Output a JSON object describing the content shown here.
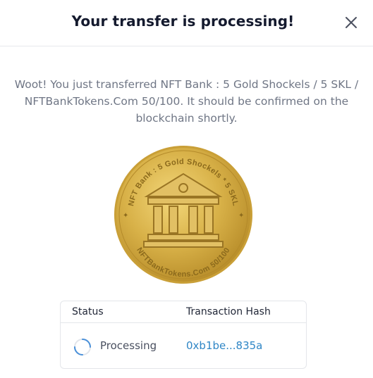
{
  "dialog": {
    "title": "Your transfer is processing!",
    "close_icon": "close-icon",
    "message": "Woot! You just transferred NFT Bank : 5 Gold Shockels / 5 SKL / NFTBankTokens.Com 50/100. It should be confirmed on the blockchain shortly."
  },
  "coin": {
    "top_text": "NFT Bank : 5 Gold Shockels * 5 SKL",
    "bottom_text": "NFTBankTokens.Com 50/100",
    "icon": "bank-building-icon",
    "gold_color": "#d8b148"
  },
  "table": {
    "headers": {
      "status": "Status",
      "hash": "Transaction Hash"
    },
    "row": {
      "status_icon": "spinner-icon",
      "status": "Processing",
      "hash": "0xb1be...835a"
    }
  },
  "colors": {
    "title": "#141a2e",
    "message": "#6f7685",
    "link": "#2f86c6",
    "border": "#e4e6ea"
  }
}
